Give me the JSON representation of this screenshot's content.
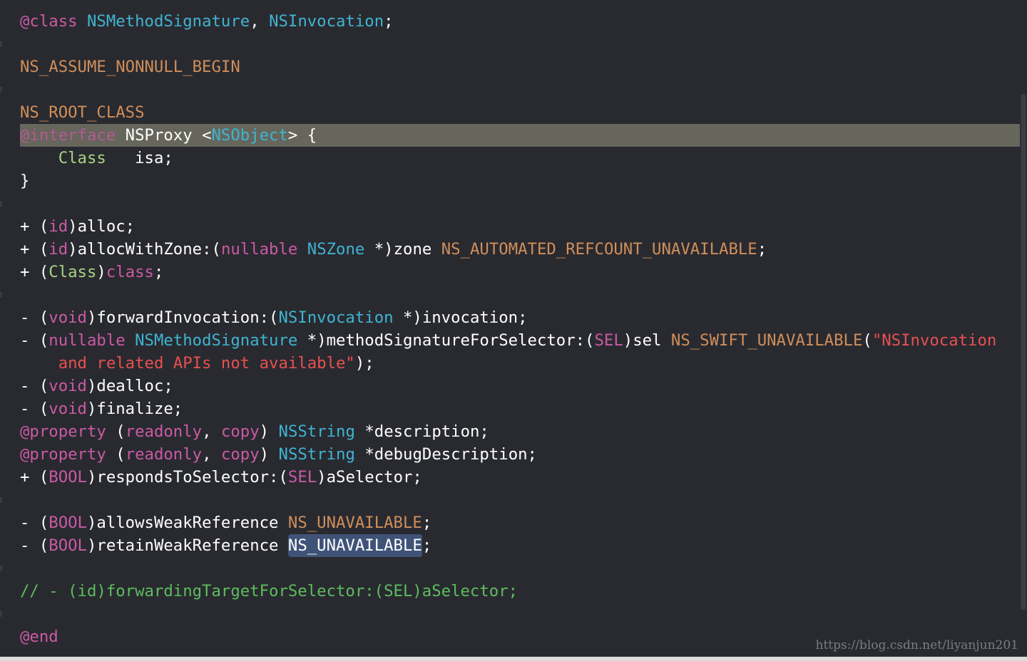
{
  "editor": {
    "lines": [
      {
        "tokens": [
          [
            "kw",
            "@class"
          ],
          [
            "plain",
            " "
          ],
          [
            "type",
            "NSMethodSignature"
          ],
          [
            "plain",
            ", "
          ],
          [
            "type",
            "NSInvocation"
          ],
          [
            "plain",
            ";"
          ]
        ]
      },
      {
        "tokens": []
      },
      {
        "tokens": [
          [
            "macro",
            "NS_ASSUME_NONNULL_BEGIN"
          ]
        ]
      },
      {
        "tokens": []
      },
      {
        "tokens": [
          [
            "macro",
            "NS_ROOT_CLASS"
          ]
        ]
      },
      {
        "highlighted": true,
        "tokens": [
          [
            "kwdim",
            "@interface"
          ],
          [
            "plain",
            " NSProxy <"
          ],
          [
            "typedim",
            "NSObject"
          ],
          [
            "plain",
            "> {"
          ]
        ]
      },
      {
        "tokens": [
          [
            "plain",
            "    "
          ],
          [
            "cls",
            "Class"
          ],
          [
            "plain",
            "   isa;"
          ]
        ]
      },
      {
        "tokens": [
          [
            "plain",
            "}"
          ]
        ]
      },
      {
        "tokens": []
      },
      {
        "tokens": [
          [
            "plain",
            "+ ("
          ],
          [
            "kw",
            "id"
          ],
          [
            "plain",
            ")alloc;"
          ]
        ]
      },
      {
        "tokens": [
          [
            "plain",
            "+ ("
          ],
          [
            "kw",
            "id"
          ],
          [
            "plain",
            ")allocWithZone:("
          ],
          [
            "kw",
            "nullable"
          ],
          [
            "plain",
            " "
          ],
          [
            "type",
            "NSZone"
          ],
          [
            "plain",
            " *)zone "
          ],
          [
            "macro",
            "NS_AUTOMATED_REFCOUNT_UNAVAILABLE"
          ],
          [
            "plain",
            ";"
          ]
        ]
      },
      {
        "tokens": [
          [
            "plain",
            "+ ("
          ],
          [
            "cls",
            "Class"
          ],
          [
            "plain",
            ")"
          ],
          [
            "kw",
            "class"
          ],
          [
            "plain",
            ";"
          ]
        ]
      },
      {
        "tokens": []
      },
      {
        "tokens": [
          [
            "plain",
            "- ("
          ],
          [
            "kw",
            "void"
          ],
          [
            "plain",
            ")forwardInvocation:("
          ],
          [
            "type",
            "NSInvocation"
          ],
          [
            "plain",
            " *)invocation;"
          ]
        ]
      },
      {
        "tokens": [
          [
            "plain",
            "- ("
          ],
          [
            "kw",
            "nullable"
          ],
          [
            "plain",
            " "
          ],
          [
            "type",
            "NSMethodSignature"
          ],
          [
            "plain",
            " *)methodSignatureForSelector:("
          ],
          [
            "kw",
            "SEL"
          ],
          [
            "plain",
            ")sel "
          ],
          [
            "macro",
            "NS_SWIFT_UNAVAILABLE"
          ],
          [
            "plain",
            "("
          ],
          [
            "str",
            "\"NSInvocation"
          ]
        ]
      },
      {
        "tokens": [
          [
            "plain",
            "    "
          ],
          [
            "str",
            "and related APIs not available\""
          ],
          [
            "plain",
            ");"
          ]
        ]
      },
      {
        "tokens": [
          [
            "plain",
            "- ("
          ],
          [
            "kw",
            "void"
          ],
          [
            "plain",
            ")dealloc;"
          ]
        ]
      },
      {
        "tokens": [
          [
            "plain",
            "- ("
          ],
          [
            "kw",
            "void"
          ],
          [
            "plain",
            ")finalize;"
          ]
        ]
      },
      {
        "tokens": [
          [
            "kw",
            "@property"
          ],
          [
            "plain",
            " ("
          ],
          [
            "kw",
            "readonly"
          ],
          [
            "plain",
            ", "
          ],
          [
            "kw",
            "copy"
          ],
          [
            "plain",
            ") "
          ],
          [
            "type",
            "NSString"
          ],
          [
            "plain",
            " *description;"
          ]
        ]
      },
      {
        "tokens": [
          [
            "kw",
            "@property"
          ],
          [
            "plain",
            " ("
          ],
          [
            "kw",
            "readonly"
          ],
          [
            "plain",
            ", "
          ],
          [
            "kw",
            "copy"
          ],
          [
            "plain",
            ") "
          ],
          [
            "type",
            "NSString"
          ],
          [
            "plain",
            " *debugDescription;"
          ]
        ]
      },
      {
        "tokens": [
          [
            "plain",
            "+ ("
          ],
          [
            "kw",
            "BOOL"
          ],
          [
            "plain",
            ")respondsToSelector:("
          ],
          [
            "kw",
            "SEL"
          ],
          [
            "plain",
            ")aSelector;"
          ]
        ]
      },
      {
        "tokens": []
      },
      {
        "tokens": [
          [
            "plain",
            "- ("
          ],
          [
            "kw",
            "BOOL"
          ],
          [
            "plain",
            ")allowsWeakReference "
          ],
          [
            "macro",
            "NS_UNAVAILABLE"
          ],
          [
            "plain",
            ";"
          ]
        ]
      },
      {
        "tokens": [
          [
            "plain",
            "- ("
          ],
          [
            "kw",
            "BOOL"
          ],
          [
            "plain",
            ")retainWeakReference "
          ],
          [
            "sel",
            "NS_UNAVAILABLE"
          ],
          [
            "plain",
            ";"
          ]
        ]
      },
      {
        "tokens": []
      },
      {
        "tokens": [
          [
            "cmt",
            "// - (id)forwardingTargetForSelector:(SEL)aSelector;"
          ]
        ]
      },
      {
        "tokens": []
      },
      {
        "tokens": [
          [
            "kw",
            "@end"
          ]
        ]
      }
    ]
  },
  "watermark": "https://blog.csdn.net/liyanjun201",
  "colors": {
    "background": "#292a30",
    "keyword": "#ca5aa5",
    "type": "#3fb4d1",
    "macro": "#d08e5a",
    "class": "#a8d382",
    "string": "#e8504f",
    "comment": "#5dbd5e",
    "line_highlight": "#66665c",
    "selection": "#3f5377"
  }
}
